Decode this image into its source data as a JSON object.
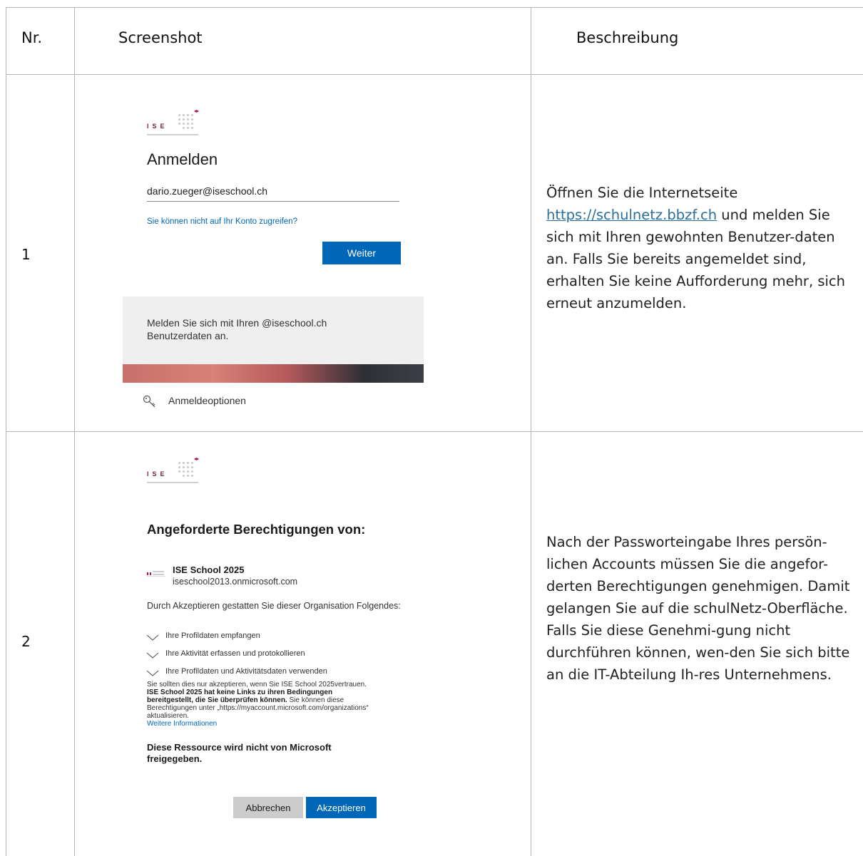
{
  "table": {
    "headers": {
      "nr": "Nr.",
      "screenshot": "Screenshot",
      "beschreibung": "Beschreibung"
    },
    "rows": [
      {
        "nr": "1",
        "description": {
          "pre": "Öffnen Sie die Internetseite ",
          "link": "https://schulnetz.bbzf.ch",
          "post": " und melden Sie sich mit Ihren gewohnten Benutzer-daten an. Falls Sie bereits angemeldet sind, erhalten Sie keine Aufforderung mehr, sich erneut anzumelden."
        }
      },
      {
        "nr": "2",
        "description": "Nach der Passworteingabe Ihres persön-lichen Accounts müssen Sie die angefor-derten Berechtigungen genehmigen. Damit gelangen Sie auf die schulNetz-Oberfläche. Falls Sie diese Genehmi-gung nicht durchführen können, wen-den Sie sich bitte an die IT-Abteilung Ih-res Unternehmens."
      }
    ]
  },
  "signin": {
    "logo_letters": "ISE",
    "title": "Anmelden",
    "email_value": "dario.zueger@iseschool.ch",
    "cant_access": "Sie können nicht auf Ihr Konto zugreifen?",
    "next_button": "Weiter",
    "info": "Melden Sie sich mit Ihren @iseschool.ch Benutzerdaten an.",
    "options": "Anmeldeoptionen"
  },
  "consent": {
    "logo_letters": "ISE",
    "title": "Angeforderte Berechtigungen von:",
    "org_name": "ISE School 2025",
    "org_domain": "iseschool2013.onmicrosoft.com",
    "intro": "Durch Akzeptieren gestatten Sie dieser Organisation Folgendes:",
    "permissions": [
      "Ihre Profildaten empfangen",
      "Ihre Aktivität erfassen und protokollieren",
      "Ihre Profildaten und Aktivitätsdaten verwenden"
    ],
    "fine_pre": "Sie sollten dies nur akzeptieren, wenn Sie ISE School 2025vertrauen. ",
    "fine_bold": "ISE School 2025 hat keine Links zu ihren Bedingungen bereitgestellt, die Sie überprüfen können.",
    "fine_post": " Sie können diese Berechtigungen unter „https://myaccount.microsoft.com/organizations“ aktualisieren.",
    "more_info": "Weitere Informationen",
    "warning": "Diese Ressource wird nicht von Microsoft freigegeben.",
    "cancel_button": "Abbrechen",
    "accept_button": "Akzeptieren"
  }
}
